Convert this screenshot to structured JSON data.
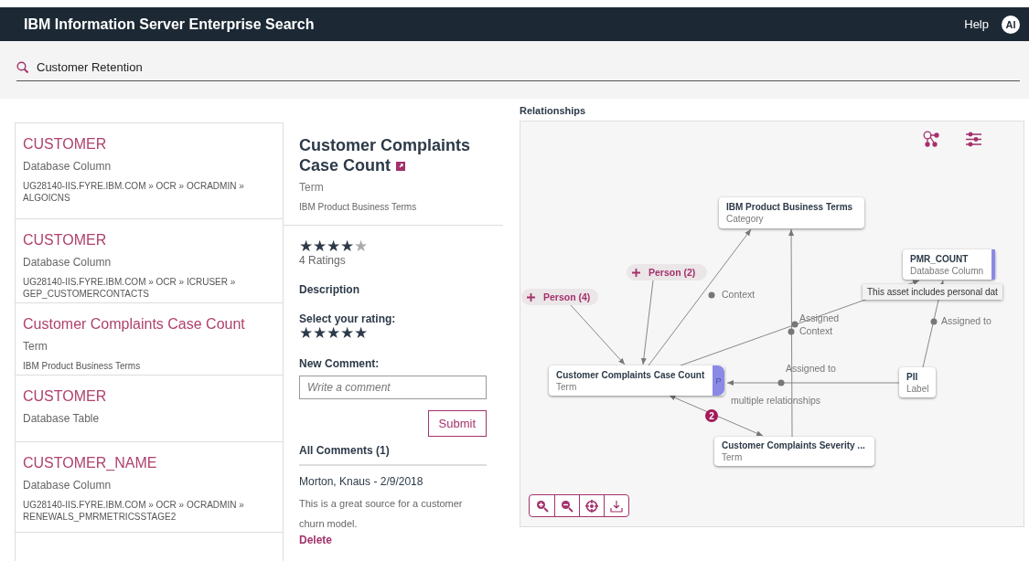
{
  "header": {
    "title": "IBM Information Server Enterprise Search",
    "help": "Help",
    "avatar": "AI"
  },
  "search": {
    "value": "Customer Retention"
  },
  "results": [
    {
      "name": "CUSTOMER",
      "type": "Database Column",
      "path": "UG28140-IIS.FYRE.IBM.COM » OCR » OCRADMIN » ALGOICNS"
    },
    {
      "name": "CUSTOMER",
      "type": "Database Column",
      "path": "UG28140-IIS.FYRE.IBM.COM » OCR » ICRUSER » GEP_CUSTOMERCONTACTS"
    },
    {
      "name": "Customer Complaints Case Count",
      "type": "Term",
      "path": "IBM Product Business Terms"
    },
    {
      "name": "CUSTOMER",
      "type": "Database Table"
    },
    {
      "name": "CUSTOMER_NAME",
      "type": "Database Column",
      "path": "UG28140-IIS.FYRE.IBM.COM » OCR » OCRADMIN » RENEWALS_PMRMETRICSSTAGE2"
    }
  ],
  "detail": {
    "title": "Customer Complaints Case Count",
    "type": "Term",
    "category": "IBM Product Business Terms",
    "stars": 4,
    "ratings": "4 Ratings",
    "description_label": "Description",
    "rating_prompt": "Select your rating:",
    "rating_input": {
      "stars": 5
    },
    "comment_label": "New Comment:",
    "comment_placeholder": "Write a comment",
    "submit": "Submit",
    "comments_heading": "All Comments (1)",
    "comments": [
      {
        "author": "Morton, Knaus - 2/9/2018",
        "text": "This is a great source for a customer churn model.",
        "delete": "Delete"
      }
    ]
  },
  "relationships": {
    "title": "Relationships",
    "nodes": [
      {
        "kind": "asset",
        "name": "IBM Product Business Terms",
        "type": "Category",
        "personal_data": false
      },
      {
        "kind": "asset",
        "name": "PMR_COUNT",
        "type": "Database Column",
        "personal_data": true
      },
      {
        "kind": "group",
        "name": "Person (2)"
      },
      {
        "kind": "group",
        "name": "Person (4)"
      },
      {
        "kind": "asset",
        "name": "Customer Complaints Case Count",
        "type": "Term",
        "personal_data": true,
        "tab_label": "P"
      },
      {
        "kind": "asset",
        "name": "PII",
        "type": "Label",
        "personal_data": false
      },
      {
        "kind": "asset",
        "name": "Customer Complaints Severity ...",
        "type": "Term",
        "personal_data": false
      }
    ],
    "edge_labels": [
      "Context",
      "Assigned",
      "Context",
      "Assigned to",
      "Assigned to",
      "multiple relationships"
    ],
    "badge": "2",
    "tooltip": "This asset includes personal dat"
  }
}
